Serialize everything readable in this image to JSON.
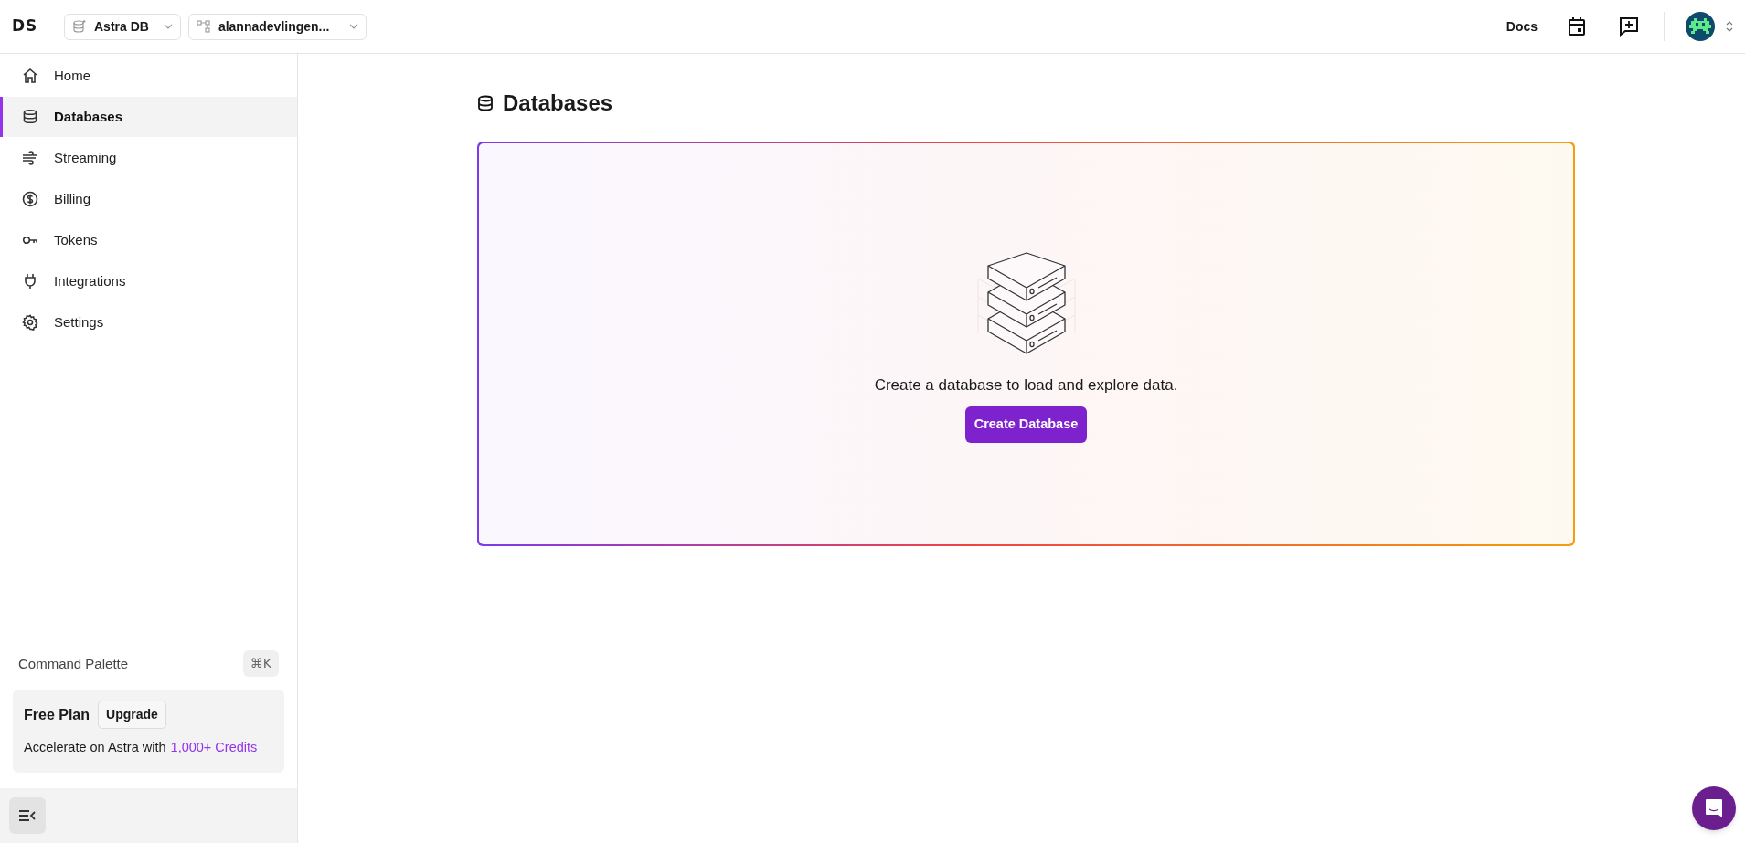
{
  "header": {
    "logo": "DS",
    "product_switcher": "Astra DB",
    "org_switcher": "alannadevlingen...",
    "docs_link": "Docs"
  },
  "sidebar": {
    "items": [
      {
        "label": "Home",
        "kind": "home",
        "selected": false
      },
      {
        "label": "Databases",
        "kind": "databases",
        "selected": true
      },
      {
        "label": "Streaming",
        "kind": "streaming",
        "selected": false
      },
      {
        "label": "Billing",
        "kind": "billing",
        "selected": false
      },
      {
        "label": "Tokens",
        "kind": "tokens",
        "selected": false
      },
      {
        "label": "Integrations",
        "kind": "integrations",
        "selected": false
      },
      {
        "label": "Settings",
        "kind": "settings",
        "selected": false
      }
    ],
    "command_palette": {
      "label": "Command Palette",
      "shortcut": "⌘K"
    },
    "plan": {
      "name": "Free Plan",
      "upgrade": "Upgrade",
      "text": "Accelerate on Astra with",
      "link": "1,000+ Credits"
    }
  },
  "main": {
    "title": "Databases",
    "empty_message": "Create a database to load and explore data.",
    "create_button": "Create Database"
  }
}
